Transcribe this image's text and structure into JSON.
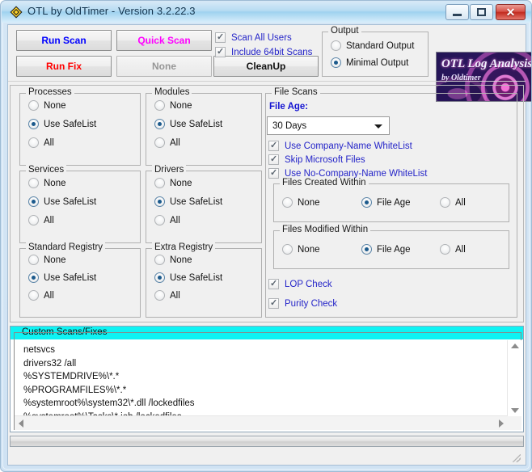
{
  "window": {
    "title": "OTL by OldTimer - Version 3.2.22.3",
    "icon": "otl-diamond-icon",
    "minimize_label": "",
    "maximize_label": "",
    "close_label": "✕"
  },
  "toolbar": {
    "run_scan": "Run Scan",
    "quick_scan": "Quick Scan",
    "run_fix": "Run Fix",
    "none_button": "None",
    "cleanup": "CleanUp",
    "checks": [
      {
        "label": "Scan All Users",
        "checked": true
      },
      {
        "label": "Include 64bit Scans",
        "checked": true
      }
    ],
    "output": {
      "title": "Output",
      "options": [
        {
          "label": "Standard Output",
          "selected": false
        },
        {
          "label": "Minimal Output",
          "selected": true
        }
      ]
    },
    "logo": {
      "line1": "OTL Log Analysis",
      "line2": "by Oldtimer"
    }
  },
  "groups": {
    "processes": {
      "title": "Processes",
      "options": [
        {
          "label": "None",
          "selected": false
        },
        {
          "label": "Use SafeList",
          "selected": true
        },
        {
          "label": "All",
          "selected": false
        }
      ]
    },
    "modules": {
      "title": "Modules",
      "options": [
        {
          "label": "None",
          "selected": false
        },
        {
          "label": "Use SafeList",
          "selected": true
        },
        {
          "label": "All",
          "selected": false
        }
      ]
    },
    "services": {
      "title": "Services",
      "options": [
        {
          "label": "None",
          "selected": false
        },
        {
          "label": "Use SafeList",
          "selected": true
        },
        {
          "label": "All",
          "selected": false
        }
      ]
    },
    "drivers": {
      "title": "Drivers",
      "options": [
        {
          "label": "None",
          "selected": false
        },
        {
          "label": "Use SafeList",
          "selected": true
        },
        {
          "label": "All",
          "selected": false
        }
      ]
    },
    "standard_registry": {
      "title": "Standard Registry",
      "options": [
        {
          "label": "None",
          "selected": false
        },
        {
          "label": "Use SafeList",
          "selected": true
        },
        {
          "label": "All",
          "selected": false
        }
      ]
    },
    "extra_registry": {
      "title": "Extra Registry",
      "options": [
        {
          "label": "None",
          "selected": false
        },
        {
          "label": "Use SafeList",
          "selected": true
        },
        {
          "label": "All",
          "selected": false
        }
      ]
    }
  },
  "file_scans": {
    "title": "File Scans",
    "file_age_label": "File Age:",
    "file_age_value": "30 Days",
    "checks": [
      {
        "label": "Use Company-Name WhiteList",
        "checked": true
      },
      {
        "label": "Skip Microsoft Files",
        "checked": true
      },
      {
        "label": "Use No-Company-Name WhiteList",
        "checked": true
      }
    ],
    "created_within": {
      "title": "Files Created Within",
      "options": [
        {
          "label": "None",
          "selected": false
        },
        {
          "label": "File Age",
          "selected": true
        },
        {
          "label": "All",
          "selected": false
        }
      ]
    },
    "modified_within": {
      "title": "Files Modified Within",
      "options": [
        {
          "label": "None",
          "selected": false
        },
        {
          "label": "File Age",
          "selected": true
        },
        {
          "label": "All",
          "selected": false
        }
      ]
    },
    "bottom_checks": [
      {
        "label": "LOP Check",
        "checked": true
      },
      {
        "label": "Purity Check",
        "checked": true
      }
    ]
  },
  "custom_scans": {
    "title": "Custom Scans/Fixes",
    "text": "netsvcs\ndrivers32 /all\n%SYSTEMDRIVE%\\*.*\n%PROGRAMFILES%\\*.*\n%systemroot%\\system32\\*.dll /lockedfiles\n%systemroot%\\Tasks\\*.job /lockedfiles"
  },
  "colors": {
    "accent_blue": "#2424c8",
    "run_scan": "#0000ff",
    "quick_scan": "#ff00ff",
    "run_fix": "#ff0000",
    "cyan_header": "#0ff3f3",
    "titlebar": "#9fd2ef"
  }
}
